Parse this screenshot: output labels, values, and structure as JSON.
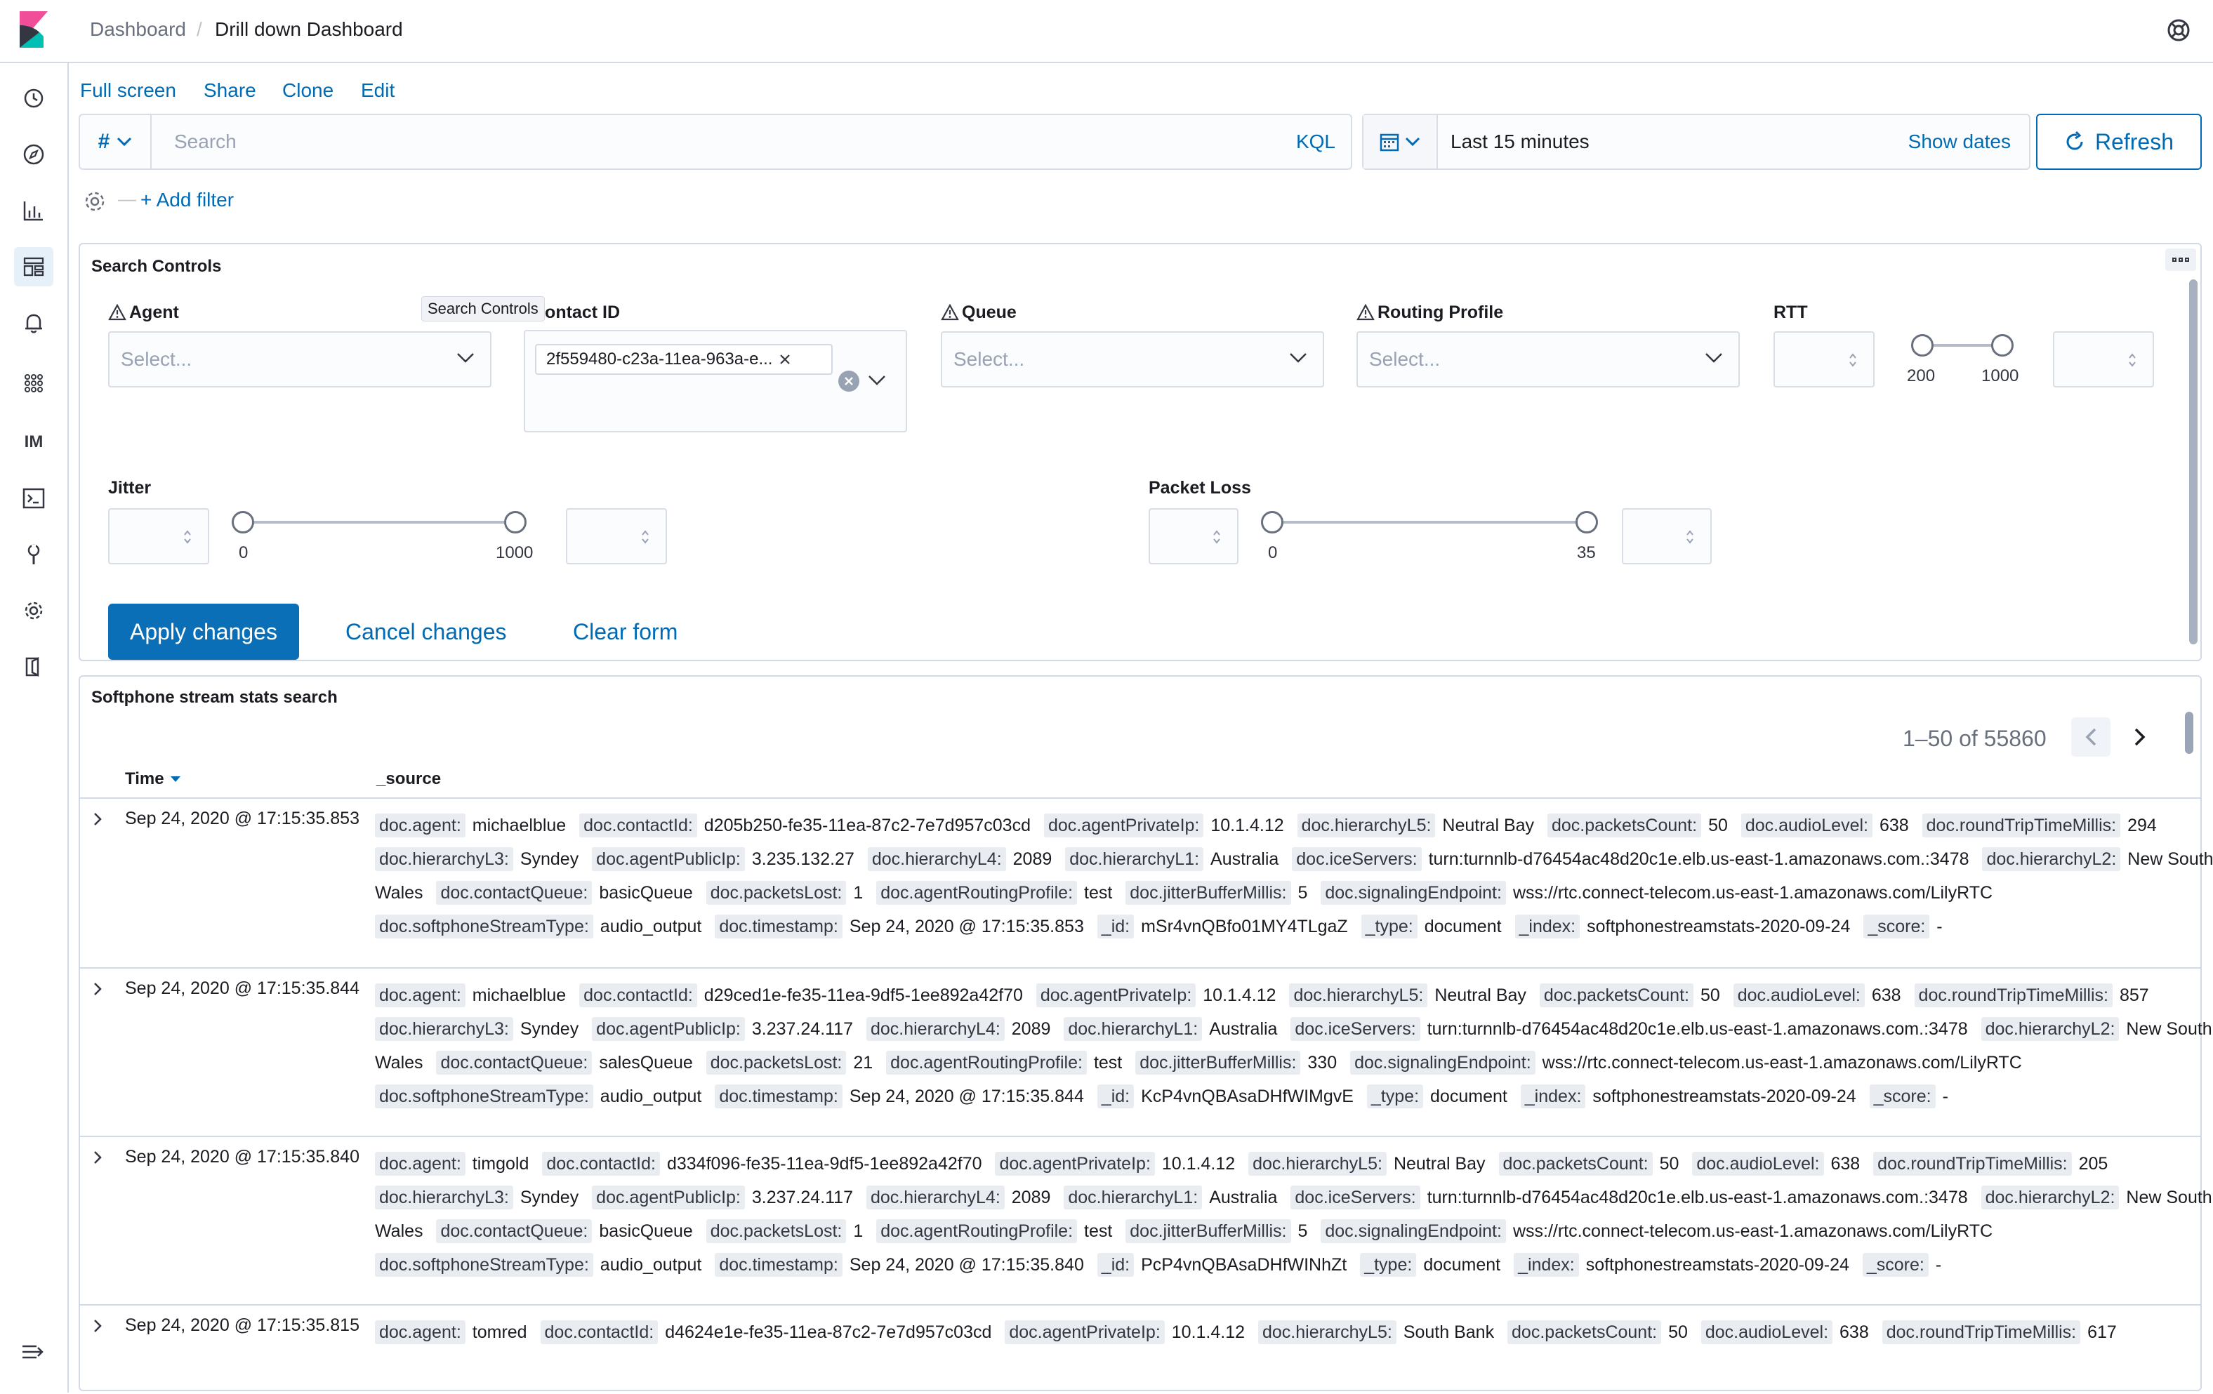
{
  "header": {
    "breadcrumb_root": "Dashboard",
    "breadcrumb_sep": "/",
    "breadcrumb_current": "Drill down Dashboard"
  },
  "sidebar": {
    "items": [
      {
        "name": "recently-viewed-icon"
      },
      {
        "name": "discover-icon"
      },
      {
        "name": "visualize-icon"
      },
      {
        "name": "dashboard-icon",
        "active": true
      },
      {
        "name": "alerting-icon"
      },
      {
        "name": "apps-grid-icon"
      },
      {
        "name": "im-label",
        "text": "IM"
      },
      {
        "name": "dev-tools-icon"
      },
      {
        "name": "wrench-icon"
      },
      {
        "name": "management-gear-icon"
      },
      {
        "name": "logout-icon"
      }
    ]
  },
  "toolbar": {
    "full_screen": "Full screen",
    "share": "Share",
    "clone": "Clone",
    "edit": "Edit"
  },
  "query": {
    "lang_symbol": "#",
    "placeholder": "Search",
    "kql": "KQL",
    "time_range": "Last 15 minutes",
    "show_dates": "Show dates",
    "refresh": "Refresh",
    "add_filter": "+ Add filter",
    "filter_dash": "—"
  },
  "controls": {
    "title": "Search Controls",
    "tooltip": "Search Controls",
    "agent_label": "Agent",
    "contact_label": "Contact ID",
    "queue_label": "Queue",
    "routing_label": "Routing Profile",
    "rtt_label": "RTT",
    "jitter_label": "Jitter",
    "packet_loss_label": "Packet Loss",
    "select_placeholder": "Select...",
    "contact_value": "2f559480-c23a-11ea-963a-e...",
    "rtt_min": "200",
    "rtt_max": "1000",
    "jitter_min": "0",
    "jitter_max": "1000",
    "loss_min": "0",
    "loss_max": "35",
    "apply": "Apply changes",
    "cancel": "Cancel changes",
    "clear": "Clear form"
  },
  "search_panel": {
    "title": "Softphone stream stats search",
    "pager": "1–50 of 55860",
    "col_time": "Time",
    "col_source": "_source"
  },
  "rows": [
    {
      "time": "Sep 24, 2020 @ 17:15:35.853",
      "fields": [
        [
          "doc.agent:",
          "michaelblue"
        ],
        [
          "doc.contactId:",
          "d205b250-fe35-11ea-87c2-7e7d957c03cd"
        ],
        [
          "doc.agentPrivateIp:",
          "10.1.4.12"
        ],
        [
          "doc.hierarchyL5:",
          "Neutral Bay"
        ],
        [
          "doc.packetsCount:",
          "50"
        ],
        [
          "doc.audioLevel:",
          "638"
        ],
        [
          "doc.roundTripTimeMillis:",
          "294"
        ],
        [
          "doc.hierarchyL3:",
          "Syndey"
        ],
        [
          "doc.agentPublicIp:",
          "3.235.132.27"
        ],
        [
          "doc.hierarchyL4:",
          "2089"
        ],
        [
          "doc.hierarchyL1:",
          "Australia"
        ],
        [
          "doc.iceServers:",
          "turn:turnnlb-d76454ac48d20c1e.elb.us-east-1.amazonaws.com.:3478"
        ],
        [
          "doc.hierarchyL2:",
          "New South Wales"
        ],
        [
          "doc.contactQueue:",
          "basicQueue"
        ],
        [
          "doc.packetsLost:",
          "1"
        ],
        [
          "doc.agentRoutingProfile:",
          "test"
        ],
        [
          "doc.jitterBufferMillis:",
          "5"
        ],
        [
          "doc.signalingEndpoint:",
          "wss://rtc.connect-telecom.us-east-1.amazonaws.com/LilyRTC"
        ],
        [
          "doc.softphoneStreamType:",
          "audio_output"
        ],
        [
          "doc.timestamp:",
          "Sep 24, 2020 @ 17:15:35.853"
        ],
        [
          "_id:",
          "mSr4vnQBfo01MY4TLgaZ"
        ],
        [
          "_type:",
          "document"
        ],
        [
          "_index:",
          "softphonestreamstats-2020-09-24"
        ],
        [
          "_score:",
          "-"
        ]
      ]
    },
    {
      "time": "Sep 24, 2020 @ 17:15:35.844",
      "fields": [
        [
          "doc.agent:",
          "michaelblue"
        ],
        [
          "doc.contactId:",
          "d29ced1e-fe35-11ea-9df5-1ee892a42f70"
        ],
        [
          "doc.agentPrivateIp:",
          "10.1.4.12"
        ],
        [
          "doc.hierarchyL5:",
          "Neutral Bay"
        ],
        [
          "doc.packetsCount:",
          "50"
        ],
        [
          "doc.audioLevel:",
          "638"
        ],
        [
          "doc.roundTripTimeMillis:",
          "857"
        ],
        [
          "doc.hierarchyL3:",
          "Syndey"
        ],
        [
          "doc.agentPublicIp:",
          "3.237.24.117"
        ],
        [
          "doc.hierarchyL4:",
          "2089"
        ],
        [
          "doc.hierarchyL1:",
          "Australia"
        ],
        [
          "doc.iceServers:",
          "turn:turnnlb-d76454ac48d20c1e.elb.us-east-1.amazonaws.com.:3478"
        ],
        [
          "doc.hierarchyL2:",
          "New South Wales"
        ],
        [
          "doc.contactQueue:",
          "salesQueue"
        ],
        [
          "doc.packetsLost:",
          "21"
        ],
        [
          "doc.agentRoutingProfile:",
          "test"
        ],
        [
          "doc.jitterBufferMillis:",
          "330"
        ],
        [
          "doc.signalingEndpoint:",
          "wss://rtc.connect-telecom.us-east-1.amazonaws.com/LilyRTC"
        ],
        [
          "doc.softphoneStreamType:",
          "audio_output"
        ],
        [
          "doc.timestamp:",
          "Sep 24, 2020 @ 17:15:35.844"
        ],
        [
          "_id:",
          "KcP4vnQBAsaDHfWIMgvE"
        ],
        [
          "_type:",
          "document"
        ],
        [
          "_index:",
          "softphonestreamstats-2020-09-24"
        ],
        [
          "_score:",
          "-"
        ]
      ]
    },
    {
      "time": "Sep 24, 2020 @ 17:15:35.840",
      "fields": [
        [
          "doc.agent:",
          "timgold"
        ],
        [
          "doc.contactId:",
          "d334f096-fe35-11ea-9df5-1ee892a42f70"
        ],
        [
          "doc.agentPrivateIp:",
          "10.1.4.12"
        ],
        [
          "doc.hierarchyL5:",
          "Neutral Bay"
        ],
        [
          "doc.packetsCount:",
          "50"
        ],
        [
          "doc.audioLevel:",
          "638"
        ],
        [
          "doc.roundTripTimeMillis:",
          "205"
        ],
        [
          "doc.hierarchyL3:",
          "Syndey"
        ],
        [
          "doc.agentPublicIp:",
          "3.237.24.117"
        ],
        [
          "doc.hierarchyL4:",
          "2089"
        ],
        [
          "doc.hierarchyL1:",
          "Australia"
        ],
        [
          "doc.iceServers:",
          "turn:turnnlb-d76454ac48d20c1e.elb.us-east-1.amazonaws.com.:3478"
        ],
        [
          "doc.hierarchyL2:",
          "New South Wales"
        ],
        [
          "doc.contactQueue:",
          "basicQueue"
        ],
        [
          "doc.packetsLost:",
          "1"
        ],
        [
          "doc.agentRoutingProfile:",
          "test"
        ],
        [
          "doc.jitterBufferMillis:",
          "5"
        ],
        [
          "doc.signalingEndpoint:",
          "wss://rtc.connect-telecom.us-east-1.amazonaws.com/LilyRTC"
        ],
        [
          "doc.softphoneStreamType:",
          "audio_output"
        ],
        [
          "doc.timestamp:",
          "Sep 24, 2020 @ 17:15:35.840"
        ],
        [
          "_id:",
          "PcP4vnQBAsaDHfWINhZt"
        ],
        [
          "_type:",
          "document"
        ],
        [
          "_index:",
          "softphonestreamstats-2020-09-24"
        ],
        [
          "_score:",
          "-"
        ]
      ]
    },
    {
      "time": "Sep 24, 2020 @ 17:15:35.815",
      "fields": [
        [
          "doc.agent:",
          "tomred"
        ],
        [
          "doc.contactId:",
          "d4624e1e-fe35-11ea-87c2-7e7d957c03cd"
        ],
        [
          "doc.agentPrivateIp:",
          "10.1.4.12"
        ],
        [
          "doc.hierarchyL5:",
          "South Bank"
        ],
        [
          "doc.packetsCount:",
          "50"
        ],
        [
          "doc.audioLevel:",
          "638"
        ],
        [
          "doc.roundTripTimeMillis:",
          "617"
        ]
      ]
    }
  ]
}
